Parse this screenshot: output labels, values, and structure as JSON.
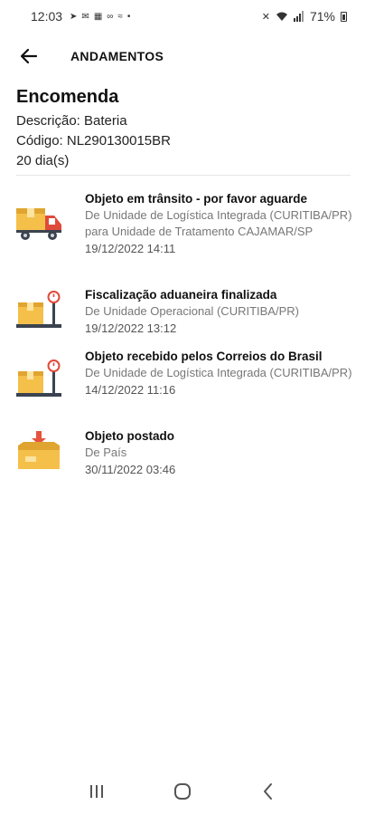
{
  "status_bar": {
    "time": "12:03",
    "battery": "71%"
  },
  "app_bar": {
    "title": "ANDAMENTOS"
  },
  "package": {
    "title": "Encomenda",
    "description": "Descrição: Bateria",
    "code": "Código: NL290130015BR",
    "days": "20 dia(s)"
  },
  "events": [
    {
      "icon": "delivery-truck-icon",
      "title": "Objeto em trânsito - por favor aguarde",
      "description": "De Unidade de Logística Integrada (CURITIBA/PR) para Unidade de Tratamento CAJAMAR/SP",
      "datetime": "19/12/2022 14:11"
    },
    {
      "icon": "package-scale-icon",
      "title": "Fiscalização aduaneira finalizada",
      "description": "De Unidade Operacional (CURITIBA/PR)",
      "datetime": "19/12/2022 13:12"
    },
    {
      "icon": "package-scale-icon",
      "title": "Objeto recebido pelos Correios do Brasil",
      "description": "De Unidade de Logística Integrada (CURITIBA/PR)",
      "datetime": "14/12/2022 11:16"
    },
    {
      "icon": "package-posted-icon",
      "title": "Objeto postado",
      "description": "De País",
      "datetime": "30/11/2022 03:46"
    }
  ],
  "colors": {
    "box": "#F5C04A",
    "box_dark": "#E0A530",
    "truck_red": "#E04A3A",
    "scale_dark": "#3B4350",
    "arrow_red": "#E5533D"
  }
}
